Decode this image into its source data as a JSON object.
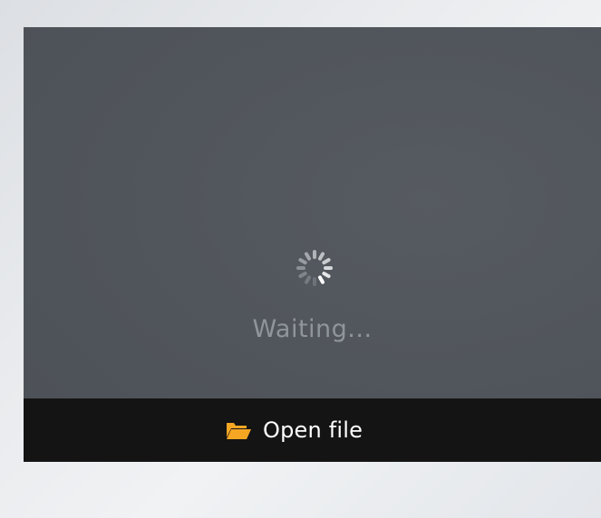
{
  "viewer": {
    "status_text": "Waiting..."
  },
  "toolbar": {
    "open_file_label": "Open file",
    "open_file_icon": "folder-open-icon",
    "accent_color": "#f5a623"
  },
  "spinner": {
    "icon": "loading-spinner-icon",
    "colors": [
      "#ffffff",
      "#6d7278",
      "#767b81",
      "#80858b",
      "#8b9096",
      "#979ca1",
      "#a3a7ac",
      "#b0b4b8",
      "#bdc0c4",
      "#cacdd0",
      "#d6d8db",
      "#e3e5e7"
    ]
  }
}
